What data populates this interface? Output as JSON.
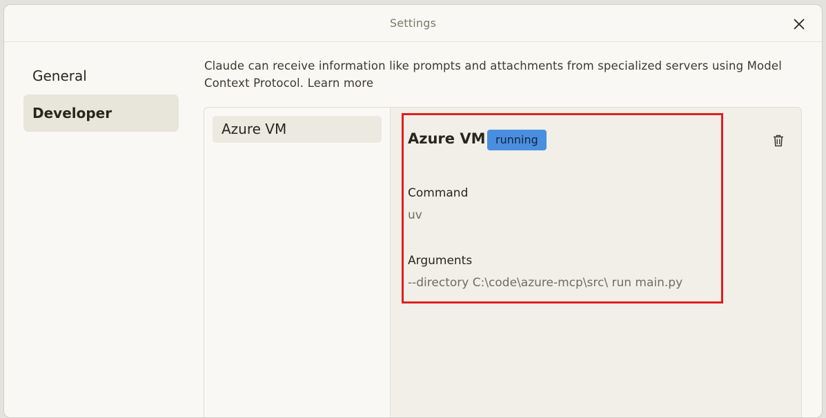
{
  "window": {
    "title": "Settings"
  },
  "sidebar": {
    "items": [
      {
        "label": "General"
      },
      {
        "label": "Developer"
      }
    ]
  },
  "intro": {
    "text": "Claude can receive information like prompts and attachments from specialized servers using Model Context Protocol.",
    "link": "Learn more"
  },
  "servers": {
    "list": [
      {
        "name": "Azure VM"
      }
    ],
    "selected": {
      "name": "Azure VM",
      "status": "running",
      "command_label": "Command",
      "command": "uv",
      "arguments_label": "Arguments",
      "arguments": "--directory C:\\code\\azure-mcp\\src\\ run main.py"
    }
  },
  "colors": {
    "status_badge": "#4a8fdf",
    "highlight": "#e01e1e",
    "selected_nav": "#e8e5da"
  }
}
